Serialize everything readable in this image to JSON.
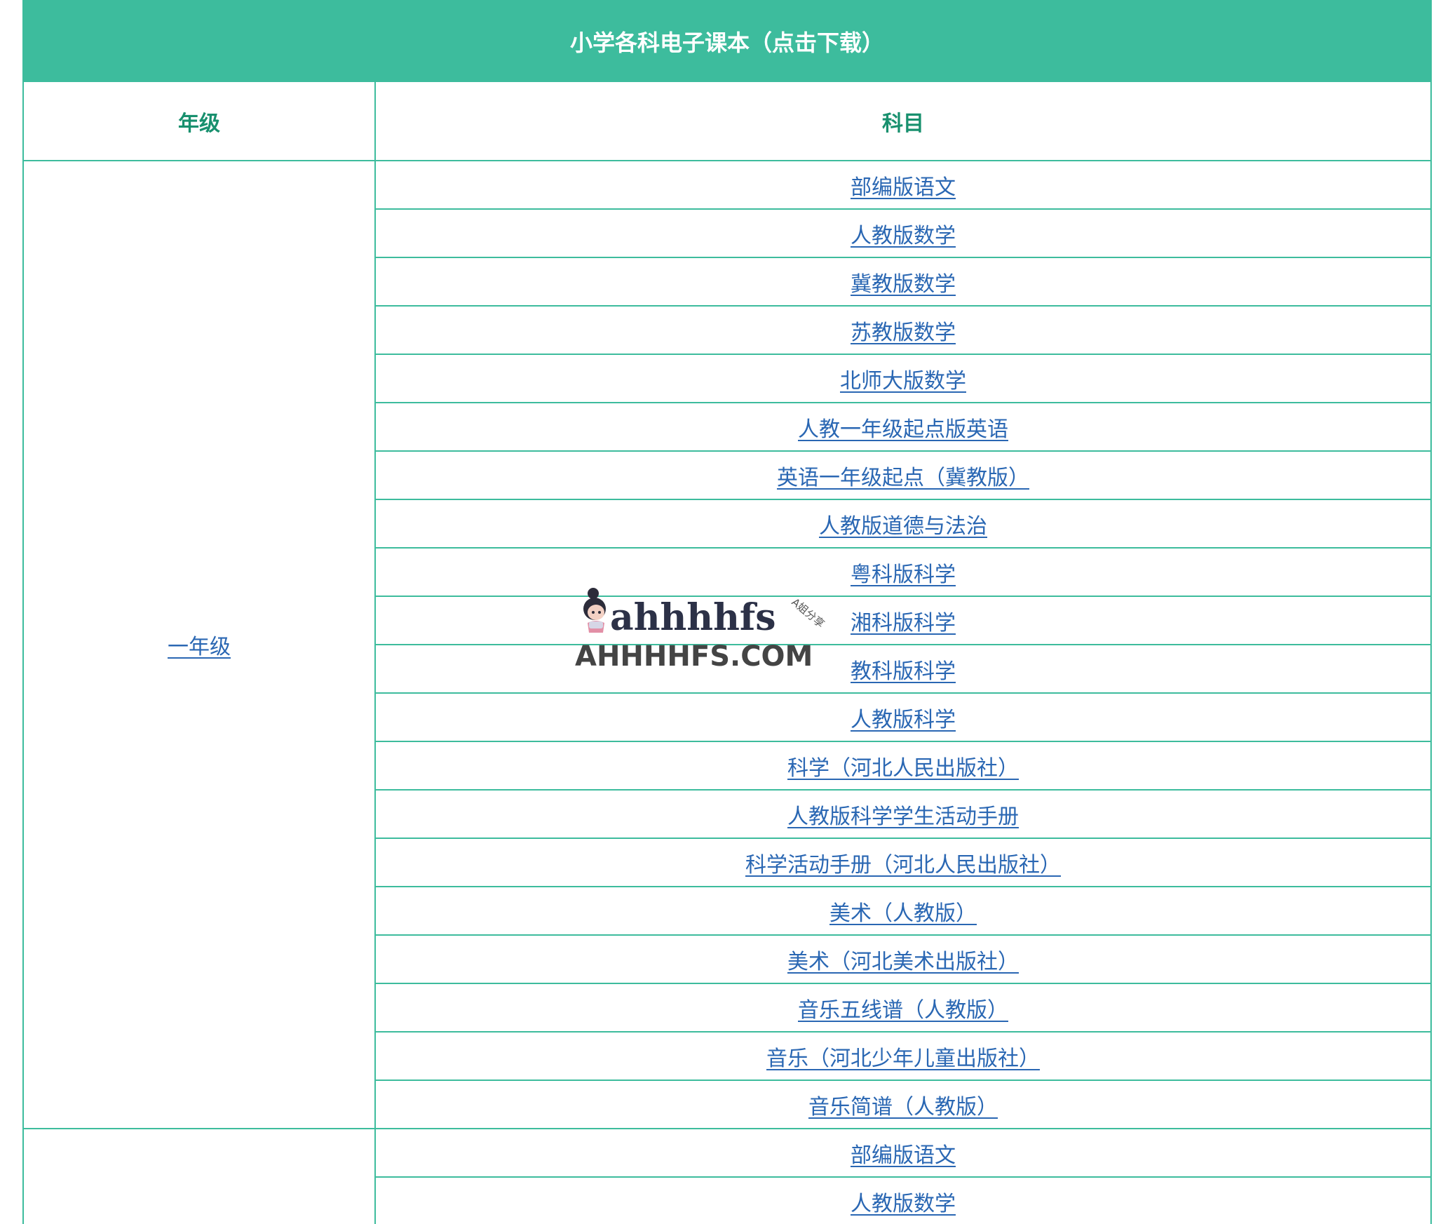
{
  "table": {
    "title": "小学各科电子课本（点击下载）",
    "header_grade": "年级",
    "header_subject": "科目",
    "grades": [
      {
        "label": "一年级",
        "subjects": [
          "部编版语文",
          "人教版数学",
          "冀教版数学",
          "苏教版数学",
          "北师大版数学",
          "人教一年级起点版英语",
          "英语一年级起点（冀教版）",
          "人教版道德与法治",
          "粤科版科学",
          "湘科版科学",
          "教科版科学",
          "人教版科学",
          "科学（河北人民出版社）",
          "人教版科学学生活动手册",
          "科学活动手册（河北人民出版社）",
          "美术（人教版）",
          "美术（河北美术出版社）",
          "音乐五线谱（人教版）",
          "音乐（河北少年儿童出版社）",
          "音乐简谱（人教版）"
        ]
      },
      {
        "label": "",
        "subjects": [
          "部编版语文",
          "人教版数学"
        ]
      }
    ]
  },
  "watermark": {
    "logo_text": "ahhhhfs",
    "badge_text": "A姐分享",
    "domain_text": "AHHHHFS.COM"
  },
  "colors": {
    "accent": "#3dbc9d",
    "header_text": "#18906e",
    "link": "#2a67b3"
  }
}
